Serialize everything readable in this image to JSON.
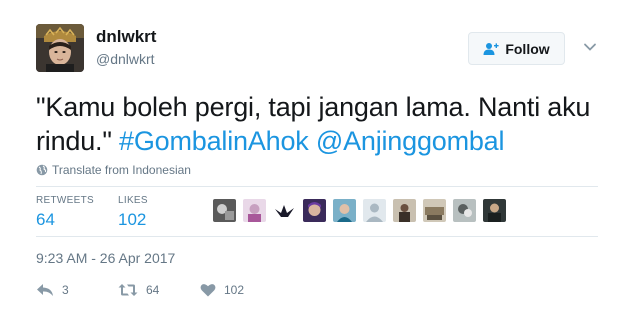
{
  "user": {
    "display_name": "dnlwkrt",
    "handle": "@dnlwkrt"
  },
  "follow_button": {
    "label": "Follow"
  },
  "tweet": {
    "text": "\"Kamu boleh pergi, tapi jangan lama. Nanti aku rindu.\"",
    "hashtag": "#GombalinAhok",
    "mention": "@Anjinggombal"
  },
  "translate": {
    "label": "Translate from Indonesian"
  },
  "stats": {
    "retweets_label": "RETWEETS",
    "retweets": "64",
    "likes_label": "LIKES",
    "likes": "102"
  },
  "timestamp": "9:23 AM - 26 Apr 2017",
  "actions": {
    "reply_count": "3",
    "retweet_count": "64",
    "like_count": "102"
  },
  "colors": {
    "link": "#1b95e0",
    "muted": "#657786",
    "text": "#14171a",
    "divider": "#e1e8ed"
  },
  "icons": [
    "follow-person-plus-icon",
    "chevron-down-icon",
    "globe-icon",
    "reply-icon",
    "retweet-icon",
    "heart-icon"
  ]
}
